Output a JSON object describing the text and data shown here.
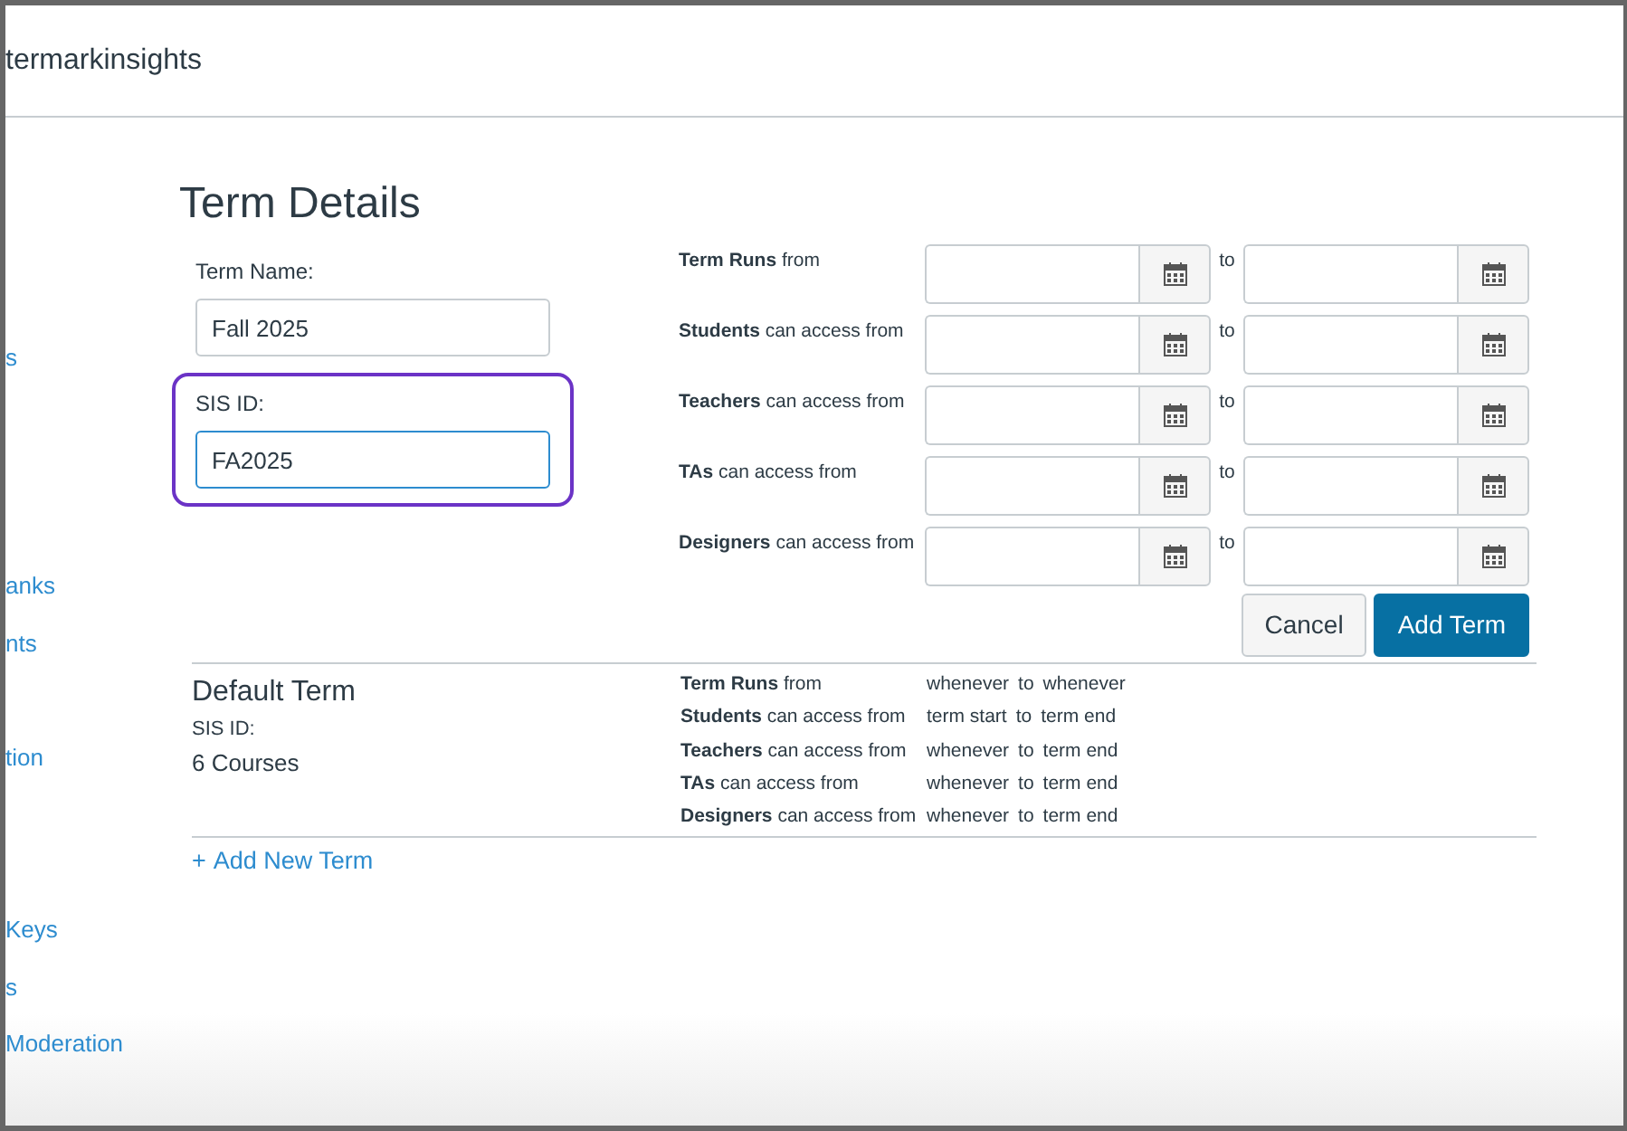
{
  "header": {
    "title": "termarkinsights"
  },
  "sidebar": {
    "items": [
      "s",
      "anks",
      "nts",
      "tion",
      "Keys",
      "s",
      "Moderation"
    ]
  },
  "form": {
    "heading": "Term Details",
    "term_name": {
      "label": "Term Name:",
      "value": "Fall 2025"
    },
    "sis_id": {
      "label": "SIS ID:",
      "value": "FA2025",
      "focused": true
    },
    "date_rows": [
      {
        "label": "**Term Runs** from",
        "to": "to"
      },
      {
        "label": "**Students** can access from",
        "to": "to"
      },
      {
        "label": "**Teachers** can access from",
        "to": "to"
      },
      {
        "label": "**TAs** can access from",
        "to": "to"
      },
      {
        "label": "**Designers** can access from",
        "to": "to"
      }
    ],
    "buttons": [
      {
        "label": "Cancel",
        "kind": "secondary"
      },
      {
        "label": "Add Term",
        "kind": "primary"
      }
    ]
  },
  "terms": [
    {
      "name": "Default Term",
      "sis_id": "SIS ID:",
      "courses": "6 Courses",
      "dates": [
        {
          "label": "**Term Runs** from",
          "start": "whenever",
          "to": "to",
          "end": "whenever"
        },
        {
          "label": "**Students** can access from",
          "start": "term start",
          "to": "to",
          "end": "term end"
        },
        {
          "label": "**Teachers** can access from",
          "start": "whenever",
          "to": "to",
          "end": "term end"
        },
        {
          "label": "**TAs** can access from",
          "start": "whenever",
          "to": "to",
          "end": "term end"
        },
        {
          "label": "**Designers** can access from",
          "start": "whenever",
          "to": "to",
          "end": "term end"
        }
      ]
    }
  ],
  "add_link": {
    "icon": "+",
    "label": "Add New Term"
  }
}
